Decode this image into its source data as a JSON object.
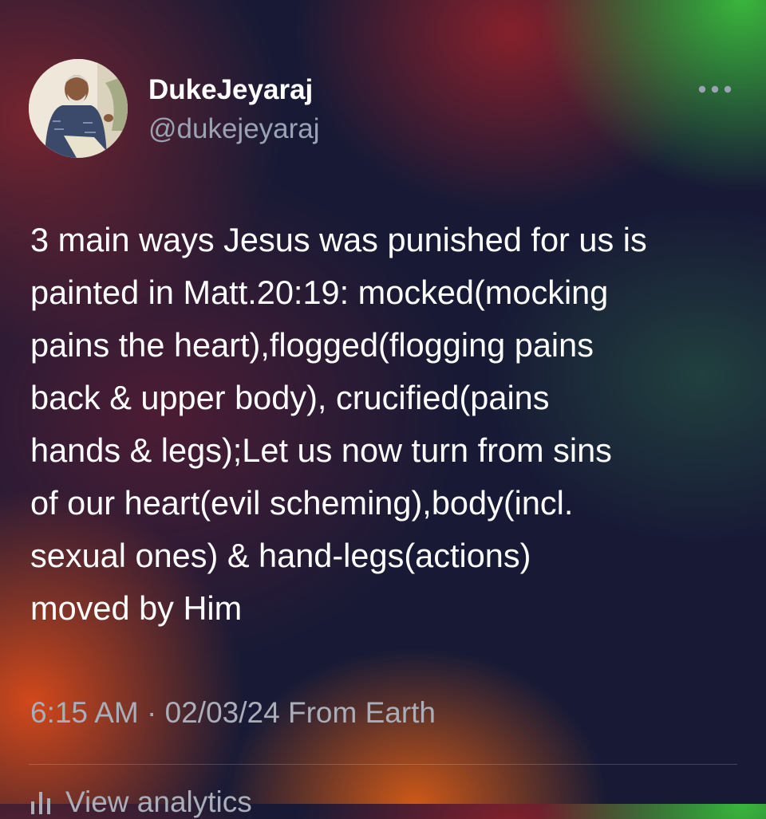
{
  "author": {
    "display_name": "DukeJeyaraj",
    "handle": "@dukejeyaraj",
    "avatar_icon": "profile-photo"
  },
  "menu": {
    "icon": "more-horizontal-icon"
  },
  "tweet": {
    "lines": [
      "3 main ways Jesus was punished for us is",
      "painted in Matt.20:19: mocked(mocking",
      "pains the heart),flogged(flogging pains",
      "back & upper body), crucified(pains",
      "hands & legs);Let us now turn from sins",
      "of our heart(evil scheming),body(incl.",
      "sexual ones) & hand-legs(actions)",
      "moved by Him"
    ],
    "time": "6:15 AM",
    "separator": "·",
    "date": "02/03/24",
    "source": "From Earth"
  },
  "actions": {
    "analytics_label": "View analytics",
    "analytics_icon": "analytics-bar-icon"
  },
  "colors": {
    "background": "#181a35",
    "text": "#ffffff",
    "secondary_text": "#a9aeb8",
    "handle_text": "#9aa3b3"
  }
}
